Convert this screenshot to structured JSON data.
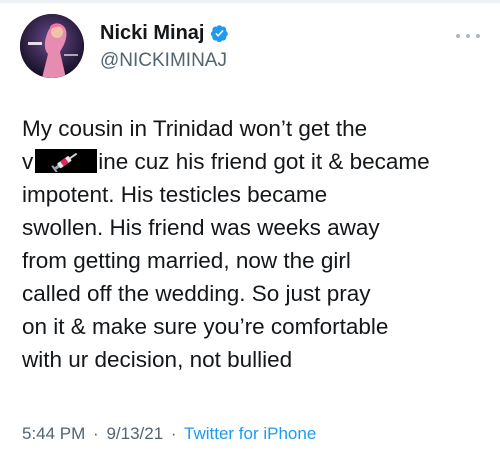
{
  "user": {
    "display_name": "Nicki Minaj",
    "handle": "@NICKIMINAJ",
    "verified": true,
    "verified_color": "#1d9bf0",
    "avatar_icon": "profile-photo"
  },
  "more_menu_icon": "more-dots-icon",
  "tweet": {
    "lines": [
      {
        "text": "My cousin in Trinidad won’t get the"
      },
      {
        "prefix": "v",
        "redaction_icon": "syringe-icon",
        "suffix": "ine cuz his friend got it & became"
      },
      {
        "text": "impotent. His testicles became"
      },
      {
        "text": "swollen. His friend was weeks away"
      },
      {
        "text": "from getting married, now the girl"
      },
      {
        "text": "called off the wedding. So just pray"
      },
      {
        "text": "on it & make sure you’re comfortable"
      },
      {
        "text": "with ur decision, not bullied"
      }
    ]
  },
  "meta": {
    "time": "5:44 PM",
    "date": "9/13/21",
    "separator": "·",
    "source": "Twitter for iPhone",
    "source_color": "#1d9bf0"
  }
}
